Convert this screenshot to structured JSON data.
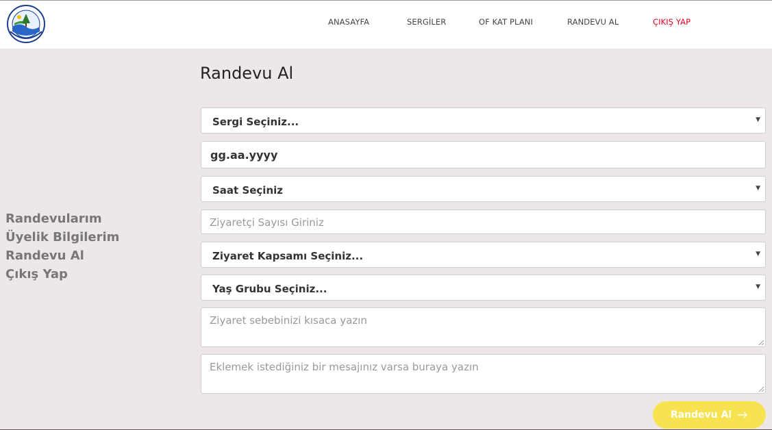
{
  "logo": {
    "arc_text": "DÜZCE ÜNİVERSİTESİ",
    "center_text": "ORMAN FAKÜLTESİ",
    "year": "1997"
  },
  "nav": {
    "items": [
      {
        "label": "ANASAYFA"
      },
      {
        "label": "SERGİLER"
      },
      {
        "label": "OF KAT PLANI"
      },
      {
        "label": "RANDEVU AL"
      },
      {
        "label": "ÇIKIŞ YAP"
      }
    ]
  },
  "sidebar": {
    "items": [
      {
        "label": "Randevularım"
      },
      {
        "label": "Üyelik Bilgilerim"
      },
      {
        "label": "Randevu Al"
      },
      {
        "label": "Çıkış Yap"
      }
    ]
  },
  "form": {
    "title": "Randevu Al",
    "exhibition_select": "Sergi Seçiniz...",
    "date_value": "gg.aa.yyyy",
    "time_select": "Saat Seçiniz",
    "visitor_count_placeholder": "Ziyaretçi Sayısı Giriniz",
    "scope_select": "Ziyaret Kapsamı Seçiniz...",
    "age_group_select": "Yaş Grubu Seçiniz...",
    "reason_placeholder": "Ziyaret sebebinizi kısaca yazın",
    "message_placeholder": "Eklemek istediğiniz bir mesajınız varsa buraya yazın",
    "submit_label": "Randevu Al"
  },
  "colors": {
    "background": "#ede7e7",
    "danger_nav": "#e8001f",
    "submit_button": "#f6e34f"
  },
  "icons": {
    "caret": "caret-down-icon",
    "submit": "arrow-right-icon"
  }
}
